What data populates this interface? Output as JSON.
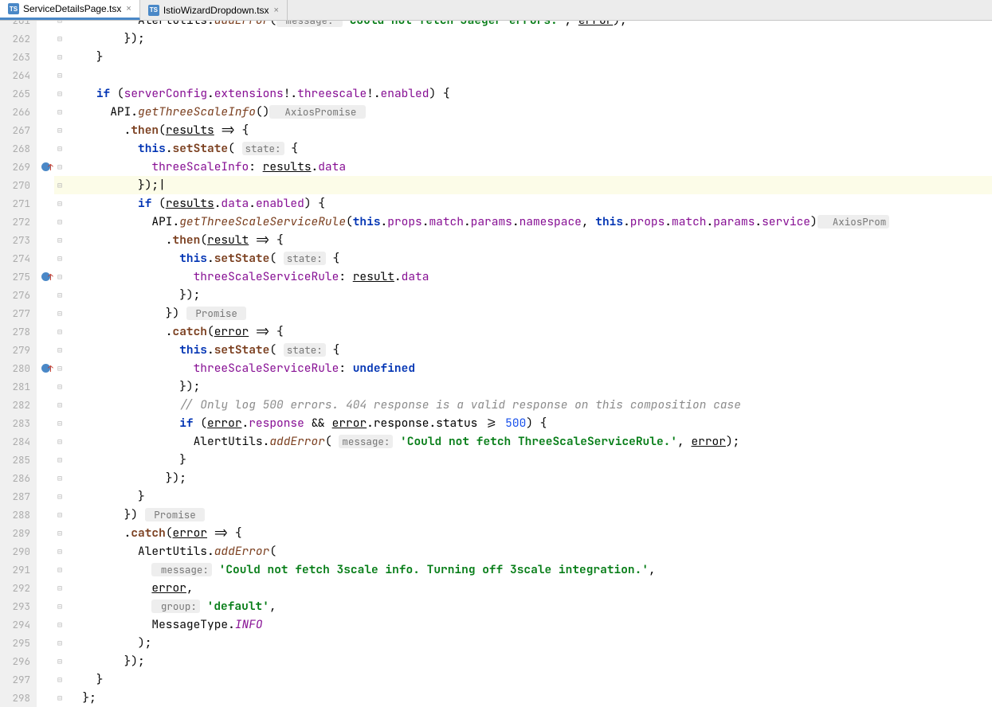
{
  "tabs": [
    {
      "label": "ServiceDetailsPage.tsx",
      "active": true
    },
    {
      "label": "IstioWizardDropdown.tsx",
      "active": false
    }
  ],
  "startLine": 261,
  "endLine": 298,
  "highlightedLine": 270,
  "breakpointLines": [
    269,
    275,
    280
  ],
  "code": {
    "l261": {
      "indent": "          ",
      "fragA": "AlertUtils.",
      "call": "addError",
      "open": "(",
      "hint": " message: ",
      "str": "'Could not fetch Jaeger errors.'",
      "comma": ", ",
      "err": "error",
      "close": ");"
    },
    "l262": "        });",
    "l263": "    }",
    "l264": "",
    "l265": {
      "if": "if",
      "open": " (",
      "a": "serverConfig",
      "dot1": ".",
      "b": "extensions",
      "bang1": "!",
      "dot2": ".",
      "c": "threescale",
      "bang2": "!",
      "dot3": ".",
      "d": "enabled",
      "close": ") {"
    },
    "l266": {
      "indent": "      ",
      "api": "API.",
      "fn": "getThreeScaleInfo",
      "paren": "()",
      "hint": "  AxiosPromise<ThreeScaleInfo> "
    },
    "l267": {
      "indent": "        .",
      "fn": "then",
      "open": "(",
      "arg": "results",
      "arrow": " => {"
    },
    "l268": {
      "indent": "          ",
      "this": "this",
      "dot": ".",
      "fn": "setState",
      "open": "( ",
      "hint": "state:",
      "brace": " {"
    },
    "l269": {
      "indent": "            ",
      "key": "threeScaleInfo",
      "colon": ": ",
      "obj": "results",
      "dot": ".",
      "prop": "data"
    },
    "l270": "          });|",
    "l271": {
      "indent": "          ",
      "if": "if",
      "open": " (",
      "a": "results",
      "dot1": ".",
      "b": "data",
      "dot2": ".",
      "c": "enabled",
      "close": ") {"
    },
    "l272": {
      "indent": "            ",
      "api": "API.",
      "fn": "getThreeScaleServiceRule",
      "open": "(",
      "this1": "this",
      "p1": ".props.match.params.",
      "ns": "namespace",
      "comma": ", ",
      "this2": "this",
      "p2": ".props.match.params.",
      "svc": "service",
      "close": ")",
      "hint": "  AxiosProm"
    },
    "l273": {
      "indent": "              .",
      "fn": "then",
      "open": "(",
      "arg": "result",
      "arrow": " => {"
    },
    "l274": {
      "indent": "                ",
      "this": "this",
      "dot": ".",
      "fn": "setState",
      "open": "( ",
      "hint": "state:",
      "brace": " {"
    },
    "l275": {
      "indent": "                  ",
      "key": "threeScaleServiceRule",
      "colon": ": ",
      "obj": "result",
      "dot": ".",
      "prop": "data"
    },
    "l276": "                });",
    "l277": {
      "indent": "              }) ",
      "hint": " Promise<void> "
    },
    "l278": {
      "indent": "              .",
      "fn": "catch",
      "open": "(",
      "arg": "error",
      "arrow": " => {"
    },
    "l279": {
      "indent": "                ",
      "this": "this",
      "dot": ".",
      "fn": "setState",
      "open": "( ",
      "hint": "state:",
      "brace": " {"
    },
    "l280": {
      "indent": "                  ",
      "key": "threeScaleServiceRule",
      "colon": ": ",
      "undef": "undefined"
    },
    "l281": "                });",
    "l282": {
      "indent": "                ",
      "comment": "// Only log 500 errors. 404 response is a valid response on this composition case"
    },
    "l283": {
      "indent": "                ",
      "if": "if",
      "open": " (",
      "a": "error",
      "dot1": ".",
      "b": "response",
      "and": " && ",
      "c": "error",
      "dot2": ".",
      "d": "response",
      "dot3": ".",
      "e": "status",
      "gte": " >= ",
      "num": "500",
      "close": ") {"
    },
    "l284": {
      "indent": "                  AlertUtils.",
      "fn": "addError",
      "open": "( ",
      "hint": "message:",
      "sp": " ",
      "str": "'Could not fetch ThreeScaleServiceRule.'",
      "comma": ", ",
      "err": "error",
      "close": ");"
    },
    "l285": "                }",
    "l286": "              });",
    "l287": "          }",
    "l288": {
      "indent": "        }) ",
      "hint": " Promise<void> "
    },
    "l289": {
      "indent": "        .",
      "fn": "catch",
      "open": "(",
      "arg": "error",
      "arrow": " => {"
    },
    "l290": {
      "indent": "          AlertUtils.",
      "fn": "addError",
      "open": "("
    },
    "l291": {
      "indent": "            ",
      "hint": " message:",
      "sp": " ",
      "str": "'Could not fetch 3scale info. Turning off 3scale integration.'",
      "comma": ","
    },
    "l292": {
      "indent": "            ",
      "err": "error",
      "comma": ","
    },
    "l293": {
      "indent": "            ",
      "hint": " group:",
      "sp": " ",
      "str": "'default'",
      "comma": ","
    },
    "l294": {
      "indent": "            MessageType.",
      "enum": "INFO"
    },
    "l295": "          );",
    "l296": "        });",
    "l297": "    }",
    "l298": "  };"
  }
}
